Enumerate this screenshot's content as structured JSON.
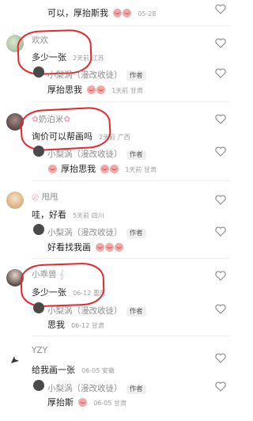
{
  "comments": [
    {
      "reply_text": "可以，厚抬斯我",
      "reply_date": "05-28"
    },
    {
      "name": "欢欢",
      "text": "多少一张",
      "meta": "2天前 江苏",
      "reply_name": "小梨涡（漫改收徒）",
      "author_badge": "作者",
      "reply_text": "厚抬思我",
      "reply_meta": "1天前 甘肃"
    },
    {
      "name": "奶泊米",
      "text": "询价可以帮画吗",
      "meta": "2天前 广西",
      "reply_name": "小梨涡（漫改收徒）",
      "author_badge": "作者",
      "reply_text": "厚抬思我",
      "reply_meta": "1天前 甘肃"
    },
    {
      "name": "甩甩",
      "text": "哇，好看",
      "meta": "5天前 四川",
      "reply_name": "小梨涡（漫改收徒）",
      "author_badge": "作者",
      "reply_text": "好看找我画",
      "reply_meta": ""
    },
    {
      "name": "小乖兽",
      "text": "多少一张",
      "meta": "06-12 重庆",
      "reply_name": "小梨涡（漫改收徒）",
      "author_badge": "作者",
      "reply_text": "思我",
      "reply_meta": "06-12 甘肃"
    },
    {
      "name": "YZY",
      "text": "给我画一张",
      "meta": "06-05 安徽",
      "reply_name": "小梨涡（漫改收徒）",
      "author_badge": "作者",
      "reply_text": "厚抬斯",
      "reply_meta": "06-05 甘肃"
    }
  ],
  "icons": {
    "like": "heart-outline-icon"
  },
  "colors": {
    "annotation": "#e5262b",
    "divider": "#efefef"
  }
}
